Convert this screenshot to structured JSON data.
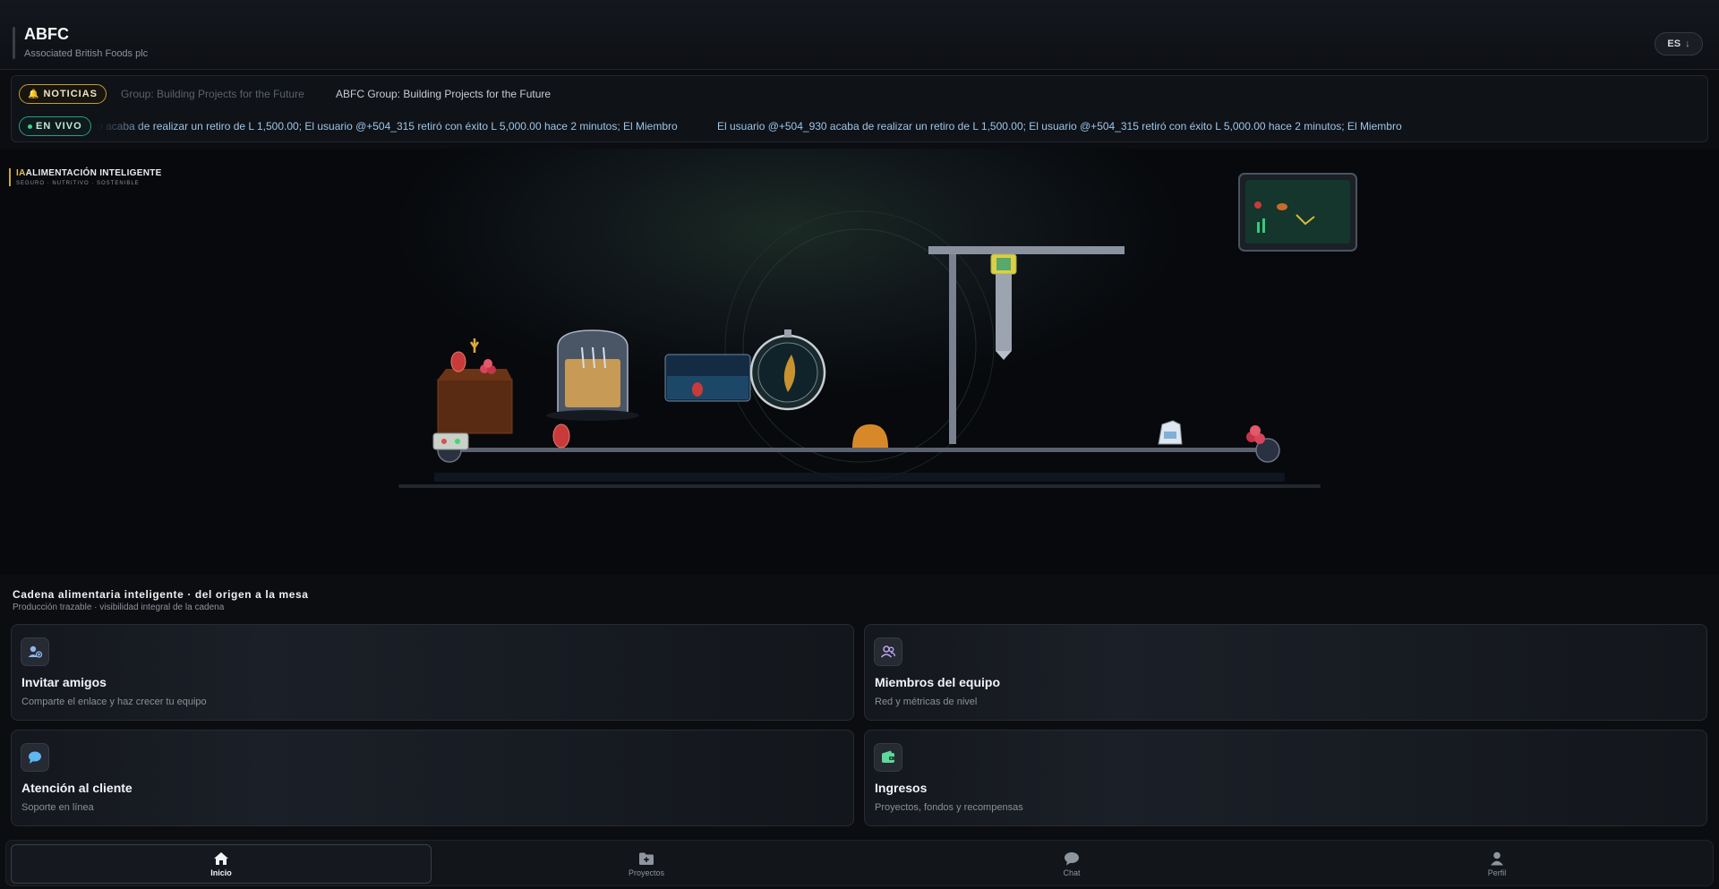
{
  "header": {
    "title": "ABFC",
    "subtitle": "Associated British Foods plc",
    "language": "ES",
    "language_arrow": "↓"
  },
  "ticker": {
    "news_label": "NOTICIAS",
    "news_faded": "Group: Building Projects for the Future",
    "news_text": "ABFC Group: Building Projects for the Future",
    "live_label": "EN VIVO",
    "live_faded": "o acaba de realizar un retiro de L 1,500.00; El usuario @+504_315 retiró con éxito L 5,000.00 hace 2 minutos; El Miembro",
    "live_text": "El usuario @+504_930 acaba de realizar un retiro de L 1,500.00; El usuario @+504_315 retiró con éxito L 5,000.00 hace 2 minutos; El Miembro"
  },
  "hero": {
    "ai_prefix": "IA",
    "ai_title": "ALIMENTACIÓN INTELIGENTE",
    "ai_subtitle": "SEGURO · NUTRITIVO · SOSTENIBLE"
  },
  "section": {
    "title": "Cadena alimentaria inteligente · del origen a la mesa",
    "subtitle": "Producción trazable · visibilidad integral de la cadena"
  },
  "cards": [
    {
      "title": "Invitar amigos",
      "subtitle": "Comparte el enlace y haz crecer tu equipo",
      "icon": "user-add-icon",
      "color": "#8fb8f0"
    },
    {
      "title": "Miembros del equipo",
      "subtitle": "Red y métricas de nivel",
      "icon": "team-icon",
      "color": "#c0a9f0"
    },
    {
      "title": "Atención al cliente",
      "subtitle": "Soporte en línea",
      "icon": "chat-bubble-icon",
      "color": "#5fb8f0"
    },
    {
      "title": "Ingresos",
      "subtitle": "Proyectos, fondos y recompensas",
      "icon": "wallet-icon",
      "color": "#5fd69a"
    }
  ],
  "nav": [
    {
      "label": "Inicio",
      "icon": "home-icon",
      "active": true
    },
    {
      "label": "Proyectos",
      "icon": "folder-add-icon",
      "active": false
    },
    {
      "label": "Chat",
      "icon": "chat-icon",
      "active": false
    },
    {
      "label": "Perfil",
      "icon": "user-icon",
      "active": false
    }
  ]
}
